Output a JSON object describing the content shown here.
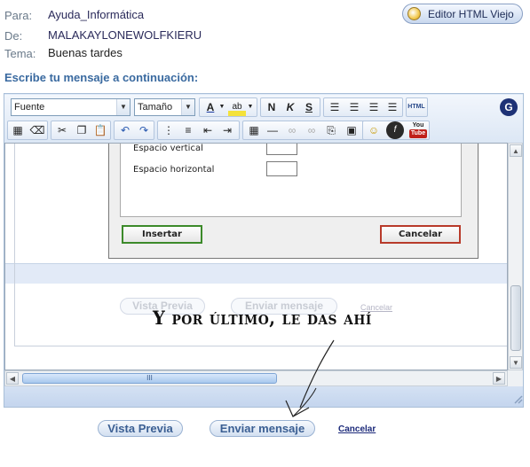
{
  "header": {
    "to_label": "Para:",
    "to_value": "Ayuda_Informática",
    "from_label": "De:",
    "from_value": "MALAKAYLONEWOLFKIERU",
    "subject_label": "Tema:",
    "subject_value": "Buenas tardes",
    "legacy_editor_button": "Editor HTML Viejo"
  },
  "prompt": "Escribe tu mensaje a continuación:",
  "toolbar": {
    "font_select": "Fuente",
    "size_select": "Tamaño",
    "bold": "N",
    "italic": "K",
    "underline": "S",
    "html_label": "HTML",
    "account_initial": "G",
    "youtube_label_1": "You",
    "youtube_label_2": "Tube"
  },
  "dialog": {
    "vertical_label": "Espacio vertical",
    "horizontal_label": "Espacio horizontal",
    "vertical_value": "",
    "horizontal_value": "",
    "insert_button": "Insertar",
    "cancel_button": "Cancelar"
  },
  "inner_form": {
    "preview_button": "Vista Previa",
    "send_button": "Enviar mensaje",
    "cancel_link": "Cancelar"
  },
  "annotation": "Y por último, le das ahí",
  "form": {
    "preview_button": "Vista Previa",
    "send_button": "Enviar mensaje",
    "cancel_link": "Cancelar"
  },
  "colors": {
    "accent": "#3a6aa0",
    "toolbar_bg": "#dce7f5",
    "insert_border": "#3c8a2a",
    "cancel_border": "#b83a2a"
  }
}
